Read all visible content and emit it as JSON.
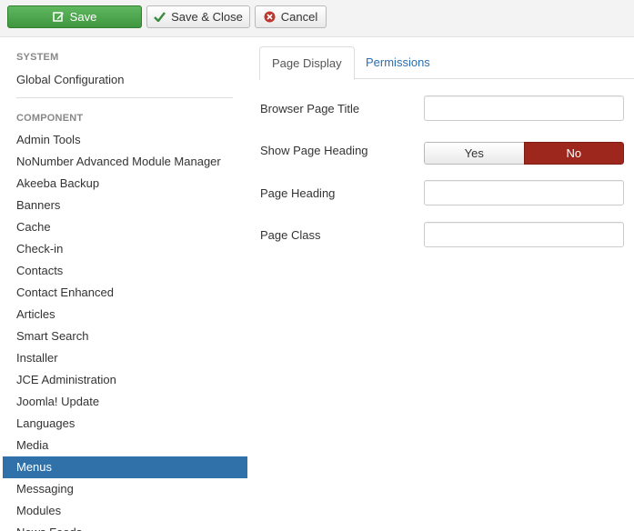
{
  "toolbar": {
    "save_label": "Save",
    "save_close_label": "Save & Close",
    "cancel_label": "Cancel"
  },
  "sidebar": {
    "system_heading": "SYSTEM",
    "global_config": "Global Configuration",
    "component_heading": "COMPONENT",
    "items": [
      "Admin Tools",
      "NoNumber Advanced Module Manager",
      "Akeeba Backup",
      "Banners",
      "Cache",
      "Check-in",
      "Contacts",
      "Contact Enhanced",
      "Articles",
      "Smart Search",
      "Installer",
      "JCE Administration",
      "Joomla! Update",
      "Languages",
      "Media",
      "Menus",
      "Messaging",
      "Modules",
      "News Feeds"
    ],
    "active_item": "Menus"
  },
  "tabs": {
    "page_display": "Page Display",
    "permissions": "Permissions"
  },
  "form": {
    "browser_page_title_label": "Browser Page Title",
    "browser_page_title_value": "",
    "show_page_heading_label": "Show Page Heading",
    "show_page_heading_yes": "Yes",
    "show_page_heading_no": "No",
    "show_page_heading_selected": "No",
    "page_heading_label": "Page Heading",
    "page_heading_value": "",
    "page_class_label": "Page Class",
    "page_class_value": ""
  },
  "colors": {
    "save_green": "#46a546",
    "active_blue": "#3071a9",
    "toggle_no_red": "#9d261d",
    "tab_link_blue": "#2a6fb0"
  }
}
